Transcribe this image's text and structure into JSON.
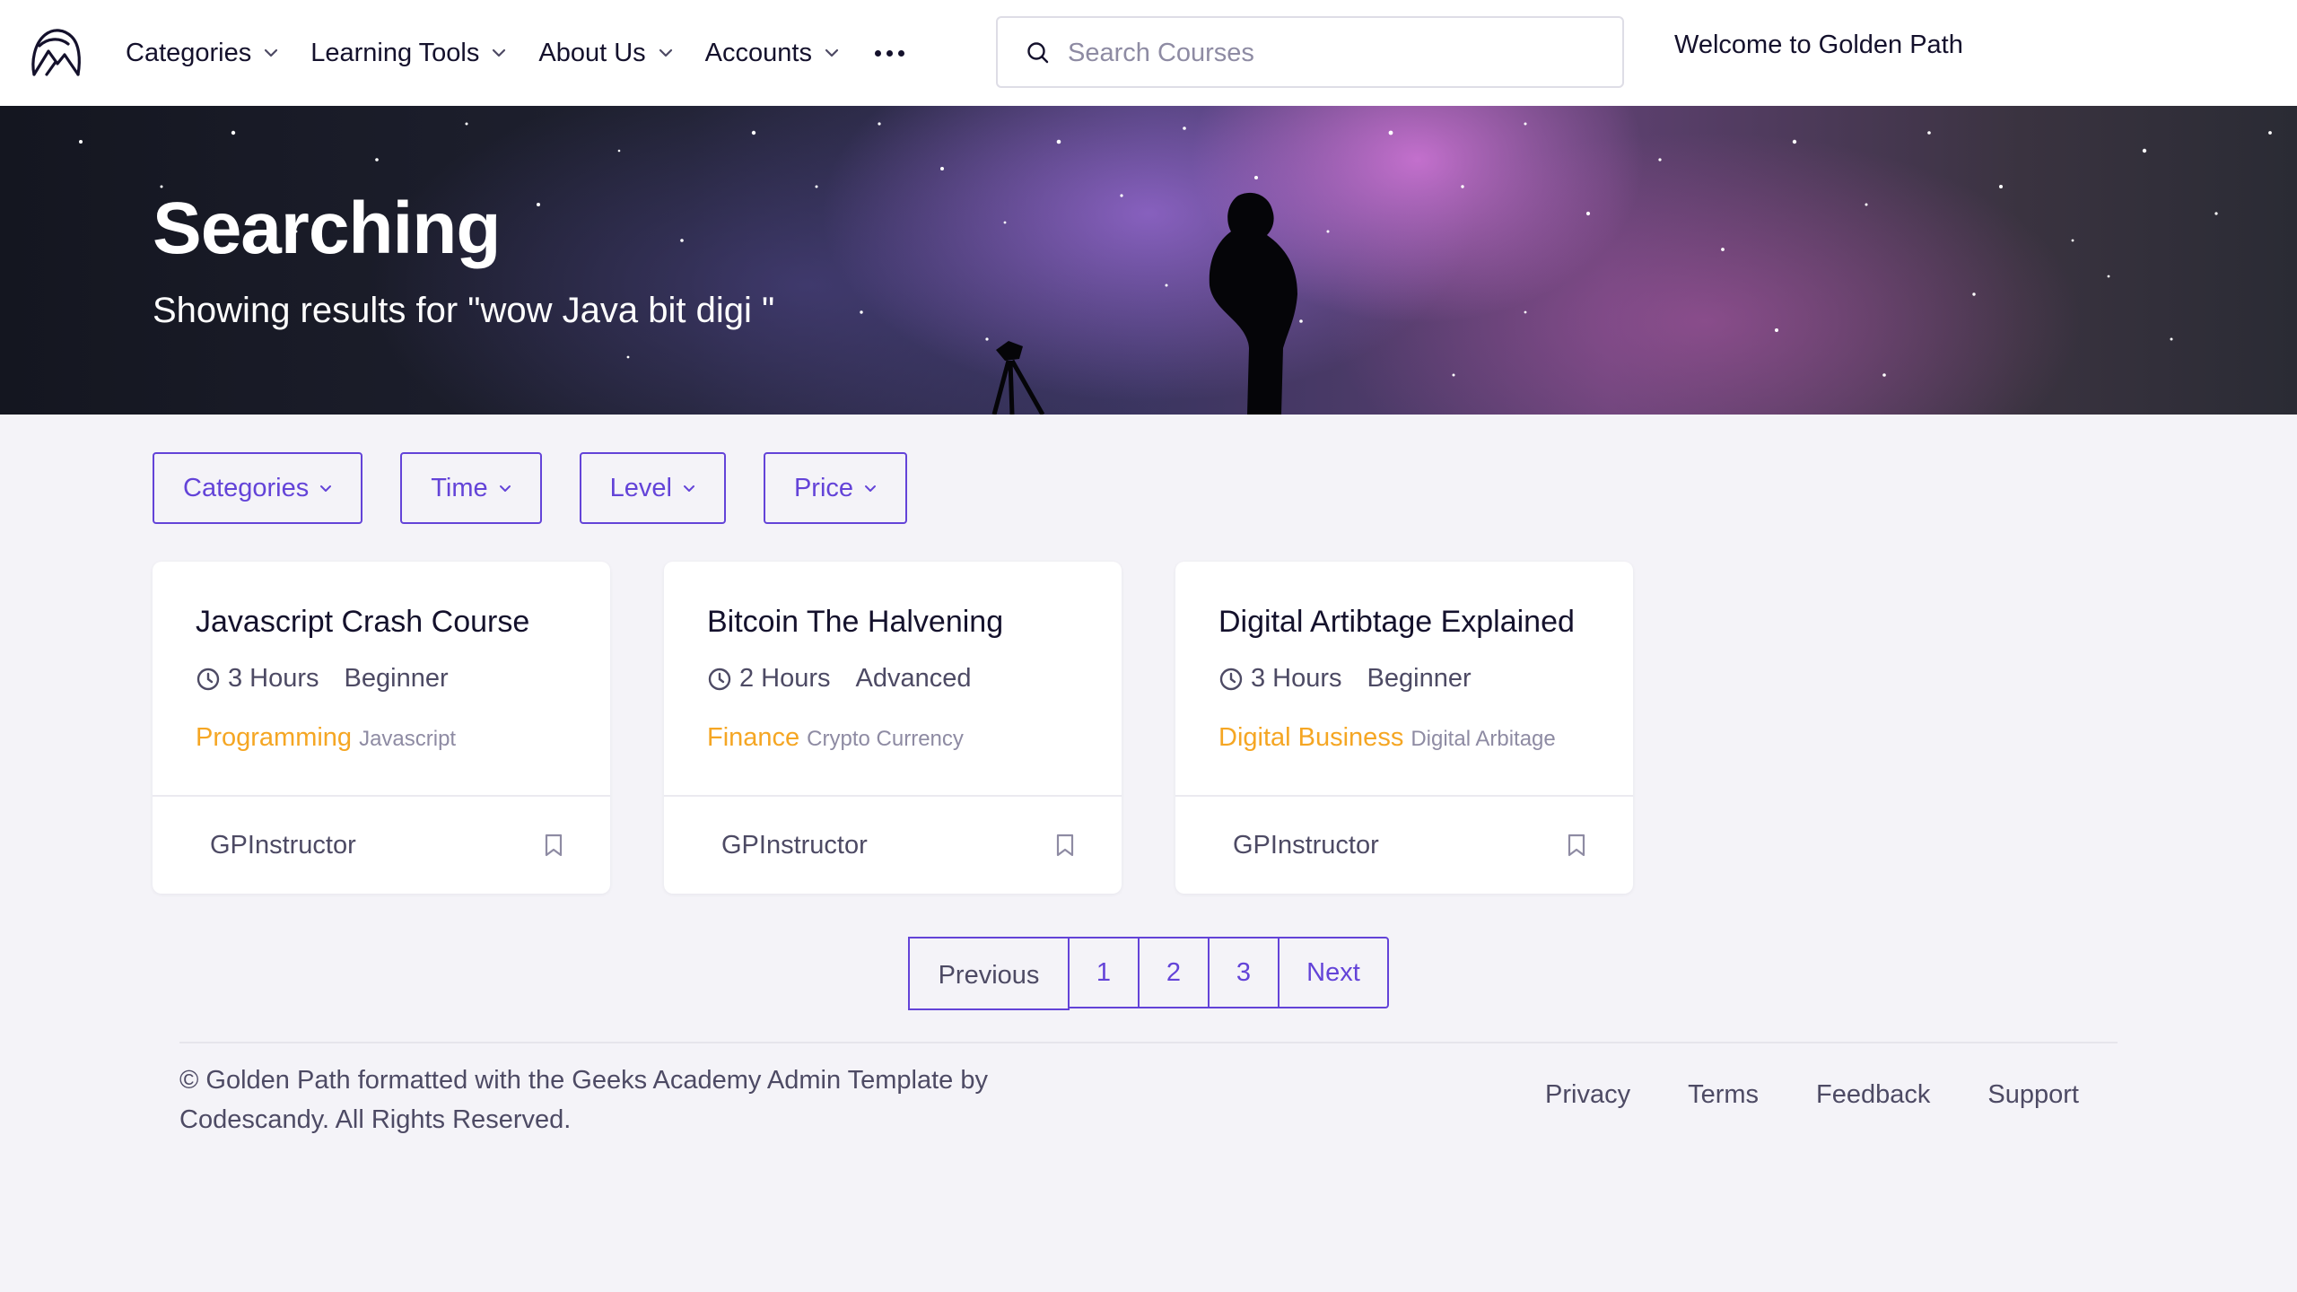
{
  "navbar": {
    "logo": "golden-path-logo",
    "items": [
      {
        "label": "Categories"
      },
      {
        "label": "Learning Tools"
      },
      {
        "label": "About Us"
      },
      {
        "label": "Accounts"
      }
    ],
    "more_icon": "more-dots-icon",
    "search": {
      "placeholder": "Search Courses",
      "value": ""
    },
    "welcome": "Welcome to Golden Path"
  },
  "hero": {
    "title": "Searching",
    "subtitle": "Showing results for \"wow Java bit digi \""
  },
  "filters": [
    {
      "label": "Categories"
    },
    {
      "label": "Time"
    },
    {
      "label": "Level"
    },
    {
      "label": "Price"
    }
  ],
  "courses": [
    {
      "title": "Javascript Crash Course",
      "duration": "3 Hours",
      "level": "Beginner",
      "category": "Programming",
      "subcategory": "Javascript",
      "instructor": "GPInstructor"
    },
    {
      "title": "Bitcoin The Halvening",
      "duration": "2 Hours",
      "level": "Advanced",
      "category": "Finance",
      "subcategory": "Crypto Currency",
      "instructor": "GPInstructor"
    },
    {
      "title": "Digital Artibtage Explained",
      "duration": "3 Hours",
      "level": "Beginner",
      "category": "Digital Business",
      "subcategory": "Digital Arbitage",
      "instructor": "GPInstructor"
    }
  ],
  "pagination": {
    "previous": "Previous",
    "pages": [
      "1",
      "2",
      "3"
    ],
    "next": "Next"
  },
  "footer": {
    "copyright": "© Golden Path formatted with the Geeks Academy Admin Template by Codescandy. All Rights Reserved.",
    "links": [
      "Privacy",
      "Terms",
      "Feedback",
      "Support"
    ]
  },
  "colors": {
    "accent": "#6343d8",
    "category": "#f5a623",
    "text": "#14112c",
    "muted": "#4d4a64",
    "background": "#f4f3f8"
  }
}
